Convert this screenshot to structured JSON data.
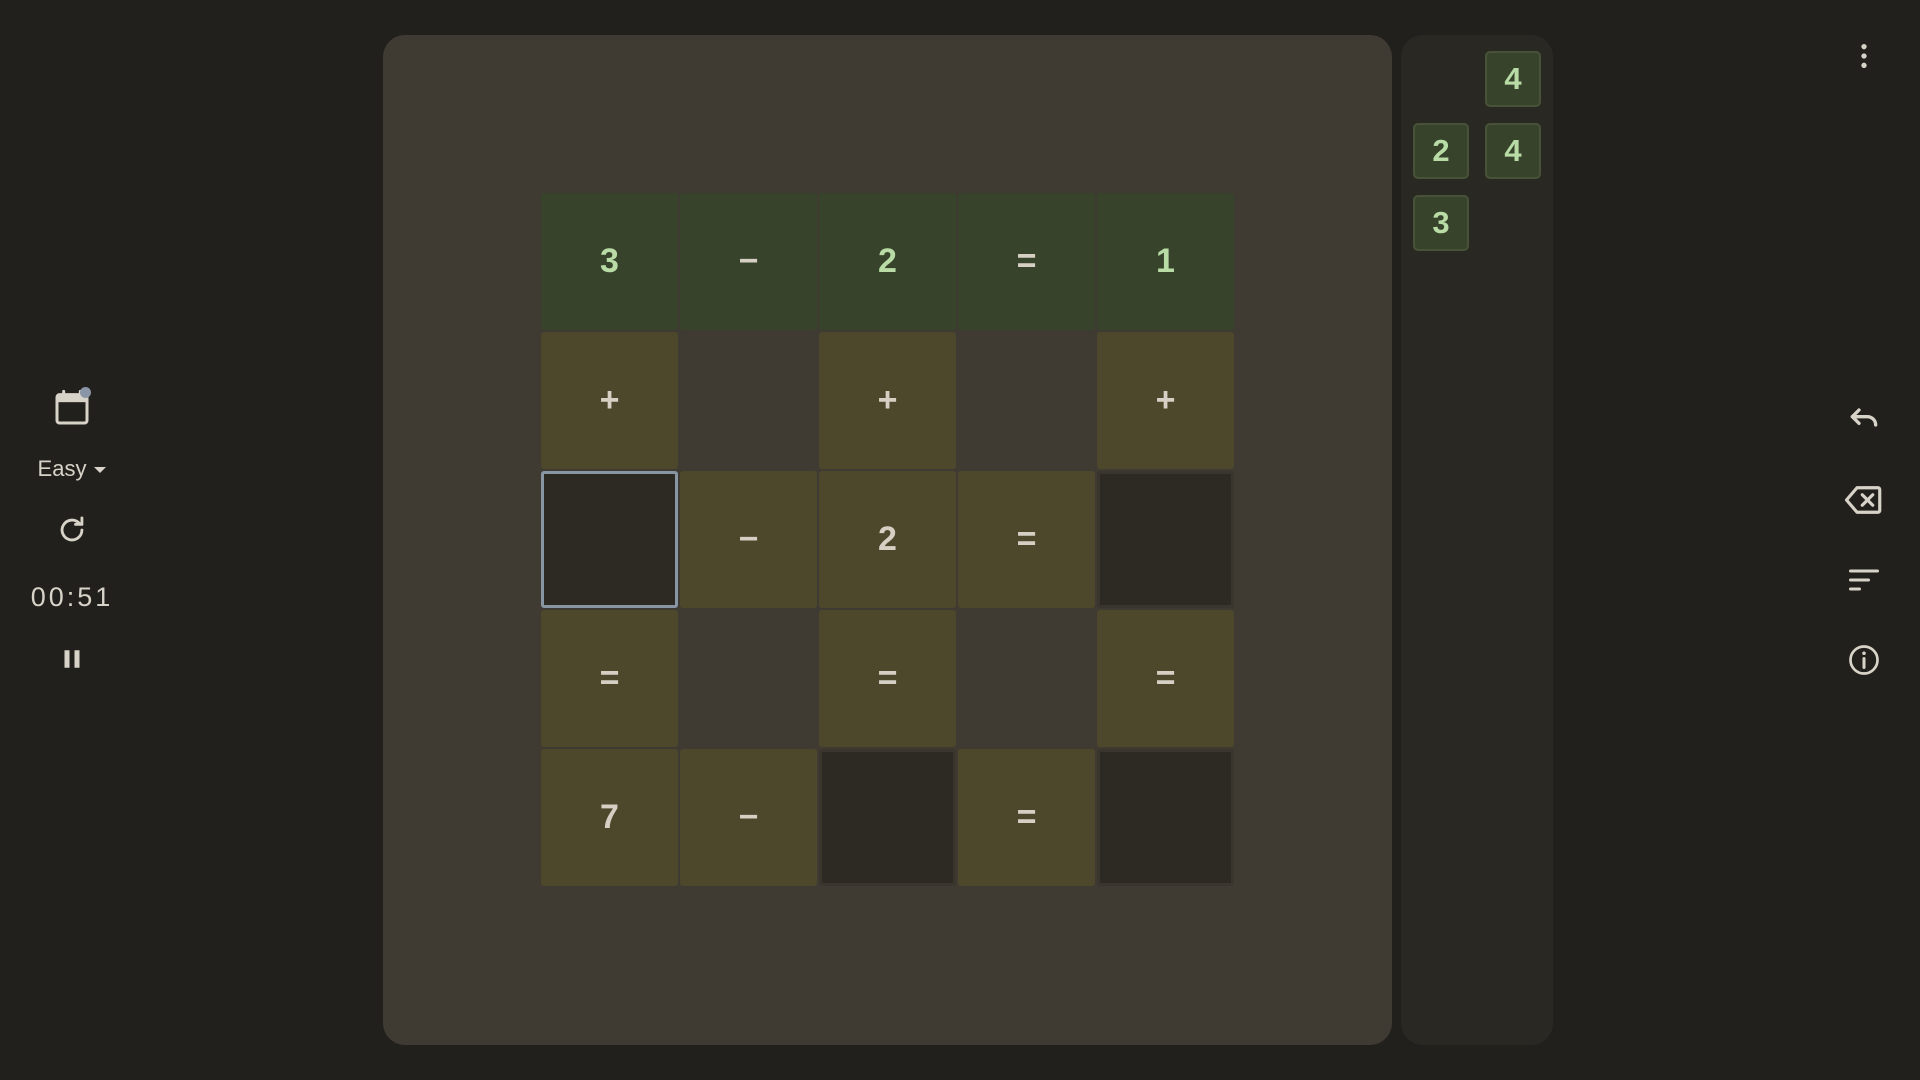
{
  "controls": {
    "difficulty": "Easy",
    "timer": "00:51"
  },
  "grid": [
    [
      {
        "t": "3",
        "s": "solved num"
      },
      {
        "t": "−",
        "s": "solved"
      },
      {
        "t": "2",
        "s": "solved num"
      },
      {
        "t": "=",
        "s": "solved"
      },
      {
        "t": "1",
        "s": "solved num"
      }
    ],
    [
      {
        "t": "+",
        "s": "given"
      },
      {
        "t": "",
        "s": "empty"
      },
      {
        "t": "+",
        "s": "given"
      },
      {
        "t": "",
        "s": "empty"
      },
      {
        "t": "+",
        "s": "given"
      }
    ],
    [
      {
        "t": "",
        "s": "selected"
      },
      {
        "t": "−",
        "s": "given"
      },
      {
        "t": "2",
        "s": "given"
      },
      {
        "t": "=",
        "s": "given"
      },
      {
        "t": "",
        "s": "blank"
      }
    ],
    [
      {
        "t": "=",
        "s": "given"
      },
      {
        "t": "",
        "s": "empty"
      },
      {
        "t": "=",
        "s": "given"
      },
      {
        "t": "",
        "s": "empty"
      },
      {
        "t": "=",
        "s": "given"
      }
    ],
    [
      {
        "t": "7",
        "s": "given"
      },
      {
        "t": "−",
        "s": "given"
      },
      {
        "t": "",
        "s": "blank"
      },
      {
        "t": "=",
        "s": "given"
      },
      {
        "t": "",
        "s": "blank"
      }
    ]
  ],
  "tiles": [
    "4",
    "2",
    "4",
    "3"
  ],
  "colors": {
    "background": "#22201c",
    "board": "#3f3b32",
    "solved_cell": "#37432b",
    "given_cell": "#4d472c",
    "blank_cell": "#2d2a24",
    "selection_outline": "#8896a4",
    "tile_text": "#b9dca6"
  },
  "icons": {
    "left": [
      "calendar-icon",
      "chevron-down-icon",
      "refresh-icon",
      "pause-icon"
    ],
    "right": [
      "more-vert-icon",
      "undo-icon",
      "backspace-icon",
      "sort-icon",
      "info-icon"
    ]
  }
}
